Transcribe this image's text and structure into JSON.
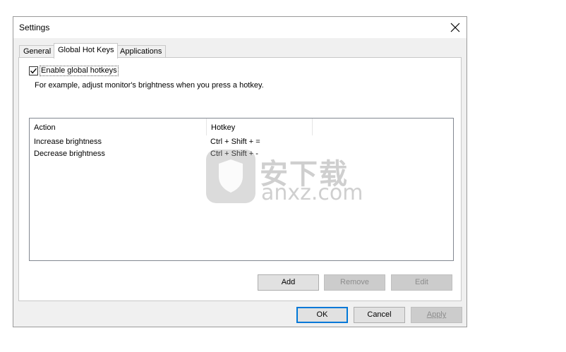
{
  "window": {
    "title": "Settings",
    "close_icon": "close-icon"
  },
  "tabs": [
    {
      "label": "General",
      "active": false
    },
    {
      "label": "Global Hot Keys",
      "active": true
    },
    {
      "label": "Applications",
      "active": false
    }
  ],
  "hotkeys_panel": {
    "enable_checkbox": {
      "label": "Enable global hotkeys",
      "checked": true
    },
    "description": "For example, adjust monitor's brightness when you press a hotkey.",
    "columns": [
      "Action",
      "Hotkey"
    ],
    "rows": [
      {
        "action": "Increase brightness",
        "hotkey": "Ctrl + Shift + ="
      },
      {
        "action": "Decrease brightness",
        "hotkey": "Ctrl + Shift + -"
      }
    ],
    "buttons": {
      "add": "Add",
      "remove": "Remove",
      "edit": "Edit"
    }
  },
  "footer": {
    "ok": "OK",
    "cancel": "Cancel",
    "apply": "Apply"
  },
  "watermark": {
    "cn": "安下载",
    "en": "anxz.com"
  }
}
